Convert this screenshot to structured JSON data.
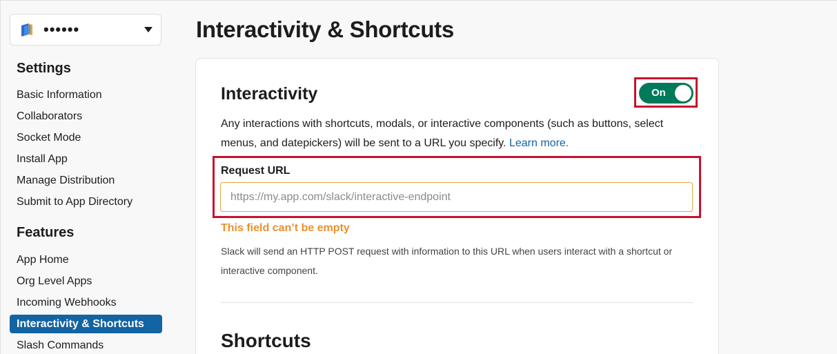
{
  "app": {
    "name": "••••••",
    "logo_icon": "app-logo-icon",
    "dropdown_icon": "chevron-down-icon"
  },
  "sidebar": {
    "settings_heading": "Settings",
    "settings_items": [
      {
        "label": "Basic Information"
      },
      {
        "label": "Collaborators"
      },
      {
        "label": "Socket Mode"
      },
      {
        "label": "Install App"
      },
      {
        "label": "Manage Distribution"
      },
      {
        "label": "Submit to App Directory"
      }
    ],
    "features_heading": "Features",
    "features_items": [
      {
        "label": "App Home"
      },
      {
        "label": "Org Level Apps"
      },
      {
        "label": "Incoming Webhooks"
      },
      {
        "label": "Interactivity & Shortcuts",
        "active": true
      },
      {
        "label": "Slash Commands"
      }
    ]
  },
  "main": {
    "title": "Interactivity & Shortcuts",
    "interactivity": {
      "title": "Interactivity",
      "toggle_label": "On",
      "toggle_state": "on",
      "description": "Any interactions with shortcuts, modals, or interactive components (such as buttons, select menus, and datepickers) will be sent to a URL you specify.",
      "learn_more": "Learn more.",
      "request_url_label": "Request URL",
      "request_url_value": "",
      "request_url_placeholder": "https://my.app.com/slack/interactive-endpoint",
      "error": "This field can’t be empty",
      "help": "Slack will send an HTTP POST request with information to this URL when users interact with a shortcut or interactive component."
    },
    "shortcuts": {
      "title": "Shortcuts"
    }
  },
  "colors": {
    "accent": "#1264a3",
    "toggle_on": "#007a5a",
    "error": "#e8912d",
    "highlight": "#c8102e"
  }
}
